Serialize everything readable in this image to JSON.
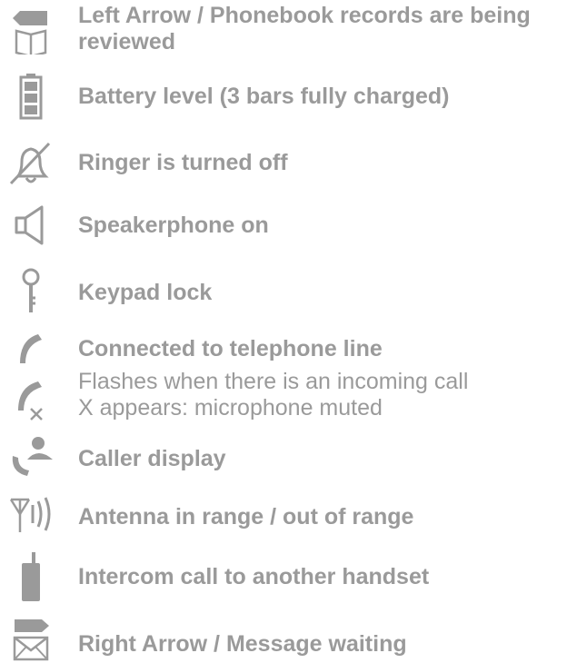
{
  "legend": {
    "items": [
      {
        "icon": "left-arrow-phonebook-icon",
        "label": "Left Arrow / Phonebook records are being reviewed"
      },
      {
        "icon": "battery-icon",
        "label": "Battery level (3 bars fully charged)"
      },
      {
        "icon": "ringer-off-icon",
        "label": "Ringer is turned off"
      },
      {
        "icon": "speaker-icon",
        "label": "Speakerphone on"
      },
      {
        "icon": "key-icon",
        "label": "Keypad lock"
      },
      {
        "icon": "handset-icon",
        "icon2": "handset-muted-icon",
        "label": "Connected to telephone line",
        "sub1": "Flashes when there is an incoming call",
        "sub2": "X appears: microphone muted"
      },
      {
        "icon": "caller-display-icon",
        "label": "Caller display"
      },
      {
        "icon": "antenna-icon",
        "label": "Antenna in range / out of range"
      },
      {
        "icon": "cordless-handset-icon",
        "label": "Intercom call to another handset"
      },
      {
        "icon": "right-arrow-envelope-icon",
        "label": "Right Arrow / Message waiting"
      }
    ]
  },
  "colors": {
    "text": "#9a9a9a",
    "icon": "#9a9a9a"
  }
}
